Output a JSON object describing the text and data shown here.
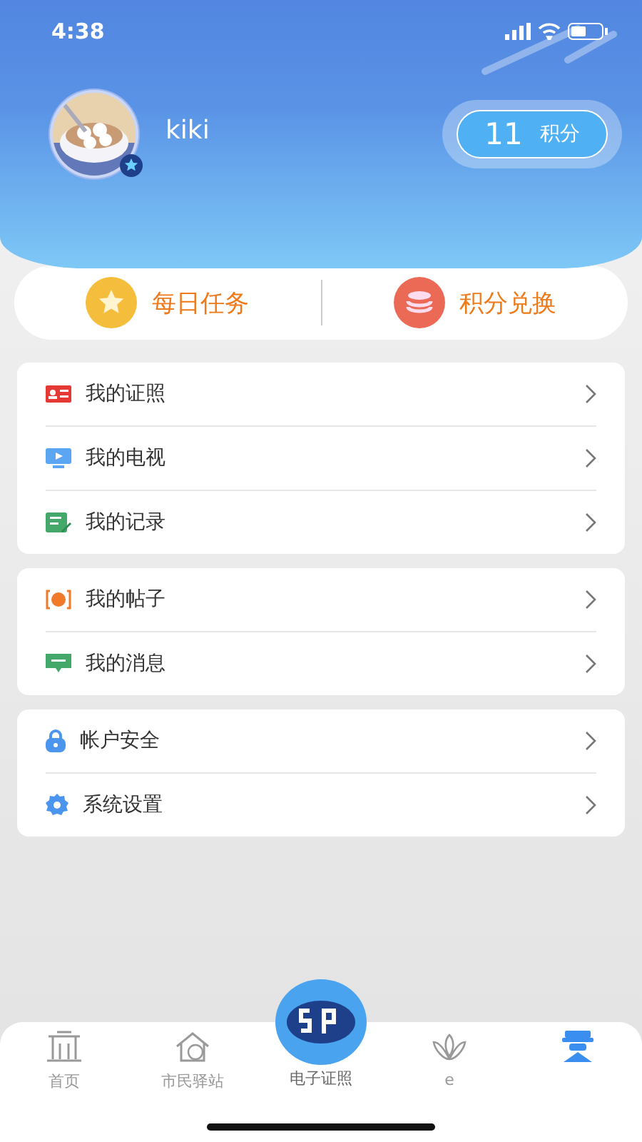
{
  "status_bar": {
    "time": "4:38"
  },
  "profile": {
    "name": "kiki",
    "points": {
      "value": "11",
      "unit": "积分"
    }
  },
  "actions": [
    {
      "label": "每日任务",
      "kind": "star"
    },
    {
      "label": "积分兑换",
      "kind": "coins"
    }
  ],
  "menu_groups": [
    [
      {
        "label": "我的证照",
        "kind": "license"
      },
      {
        "label": "我的电视",
        "kind": "tv"
      },
      {
        "label": "我的记录",
        "kind": "record"
      }
    ],
    [
      {
        "label": "我的帖子",
        "kind": "post"
      },
      {
        "label": "我的消息",
        "kind": "message"
      }
    ],
    [
      {
        "label": "帐户安全",
        "kind": "lock"
      },
      {
        "label": "系统设置",
        "kind": "gear"
      }
    ]
  ],
  "tab_bar": [
    {
      "label": "首页",
      "kind": "home",
      "selected": false
    },
    {
      "label": "市民驿站",
      "kind": "station",
      "selected": false
    },
    {
      "label": "电子证照",
      "kind": "logo",
      "selected": false
    },
    {
      "label": "e",
      "kind": "lotus",
      "selected": false
    },
    {
      "kind": "mine",
      "selected": true
    }
  ]
}
